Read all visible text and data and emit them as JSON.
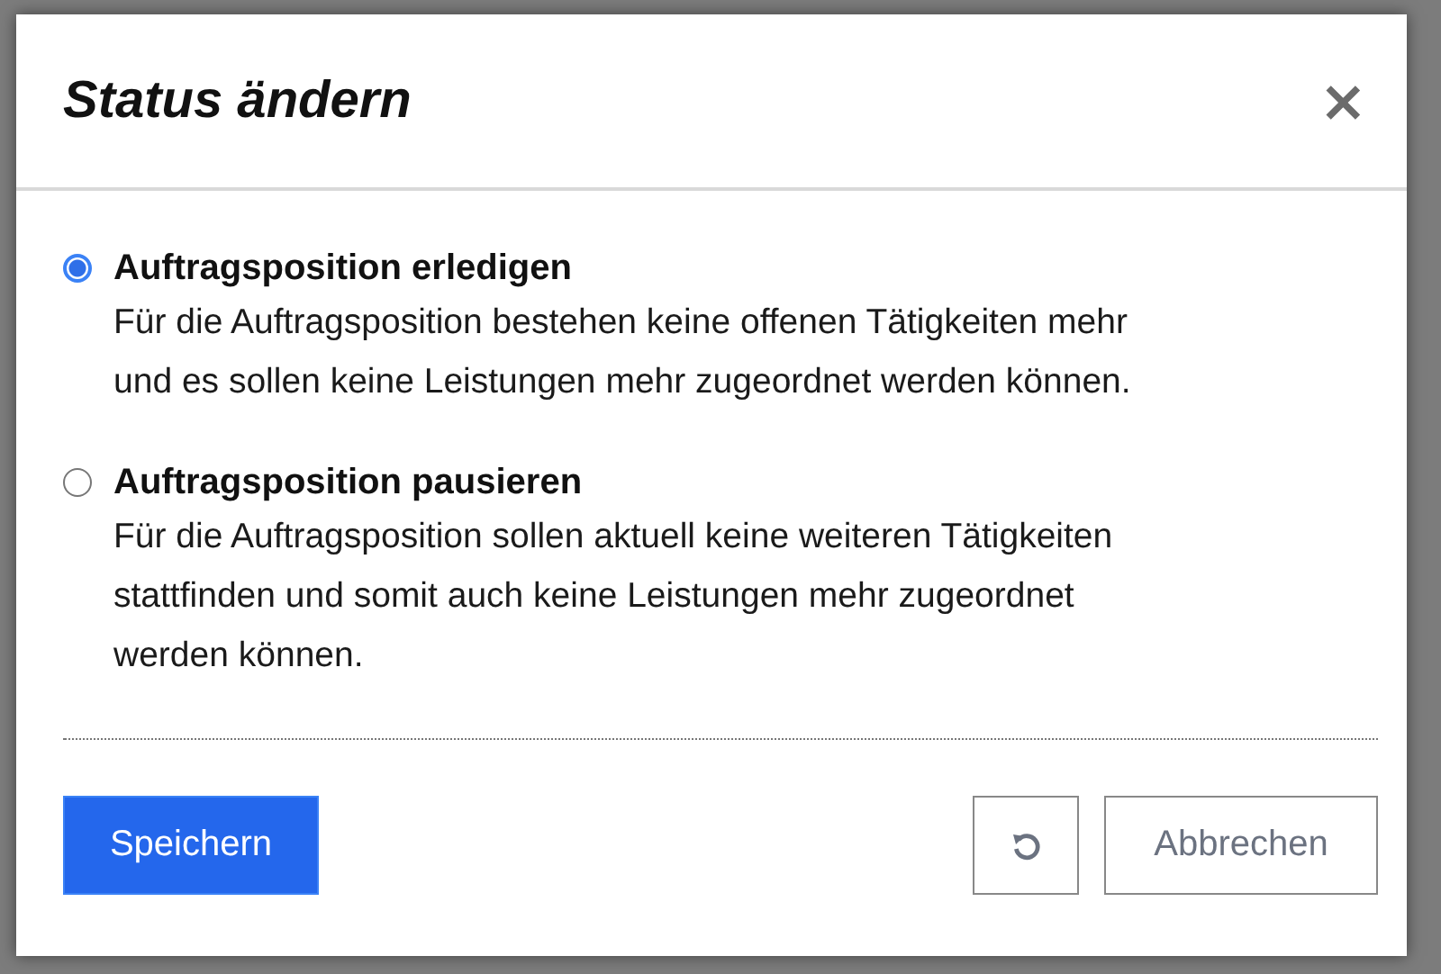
{
  "dialog": {
    "title": "Status ändern",
    "close": "×"
  },
  "options": [
    {
      "label": "Auftragsposition erledigen",
      "selected": true,
      "description": [
        "Für die Auftragsposition bestehen keine offenen Tätigkeiten mehr",
        "und es sollen keine Leistungen mehr zugeordnet werden können."
      ]
    },
    {
      "label": "Auftragsposition pausieren",
      "selected": false,
      "description": [
        "Für die Auftragsposition sollen aktuell keine weiteren Tätigkeiten",
        "stattfinden und somit auch keine Leistungen mehr zugeordnet",
        "werden können."
      ]
    }
  ],
  "buttons": {
    "save": "Speichern",
    "cancel": "Abbrechen"
  }
}
